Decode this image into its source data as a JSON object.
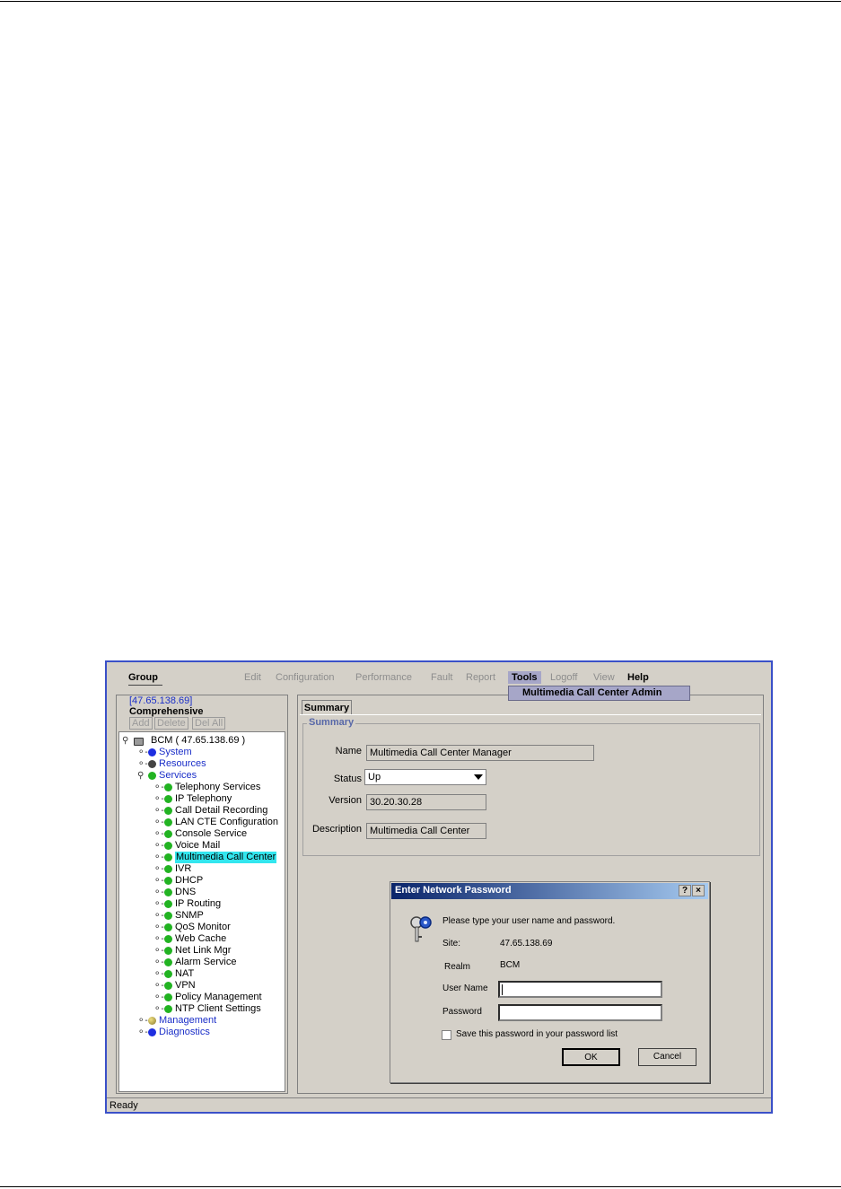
{
  "menubar": {
    "group": "Group",
    "edit": "Edit",
    "configuration": "Configuration",
    "performance": "Performance",
    "fault": "Fault",
    "report": "Report",
    "tools": "Tools",
    "logoff": "Logoff",
    "view": "View",
    "help": "Help"
  },
  "tools_menu": {
    "item": "Multimedia Call Center Admin"
  },
  "left_pane": {
    "ip": "[47.65.138.69]",
    "view": "Comprehensive",
    "buttons": {
      "add": "Add",
      "delete": "Delete",
      "del_all": "Del All"
    }
  },
  "tree": {
    "root": "BCM ( 47.65.138.69 )",
    "system": "System",
    "resources": "Resources",
    "services": "Services",
    "children": [
      "Telephony Services",
      "IP Telephony",
      "Call Detail Recording",
      "LAN CTE Configuration",
      "Console Service",
      "Voice Mail",
      "Multimedia Call Center",
      "IVR",
      "DHCP",
      "DNS",
      "IP Routing",
      "SNMP",
      "QoS Monitor",
      "Web Cache",
      "Net Link Mgr",
      "Alarm Service",
      "NAT",
      "VPN",
      "Policy Management",
      "NTP Client Settings"
    ],
    "management": "Management",
    "diagnostics": "Diagnostics"
  },
  "summary": {
    "tab": "Summary",
    "group_title": "Summary",
    "name_label": "Name",
    "name_value": "Multimedia Call Center Manager",
    "status_label": "Status",
    "status_value": "Up",
    "version_label": "Version",
    "version_value": "30.20.30.28",
    "description_label": "Description",
    "description_value": "Multimedia Call Center"
  },
  "dialog": {
    "title": "Enter Network Password",
    "help_btn": "?",
    "close_btn": "×",
    "prompt": "Please type your user name and password.",
    "site_label": "Site:",
    "site_value": "47.65.138.69",
    "realm_label": "Realm",
    "realm_value": "BCM",
    "username_label": "User Name",
    "password_label": "Password",
    "save_label": "Save this password in your password list",
    "ok": "OK",
    "cancel": "Cancel"
  },
  "status_bar": "Ready",
  "colors": {
    "window_border": "#3a50c8",
    "selection": "#33e6ee",
    "link_blue": "#1a2ec8",
    "green_dot": "#22b322",
    "blue_dot": "#1e2ee0"
  }
}
